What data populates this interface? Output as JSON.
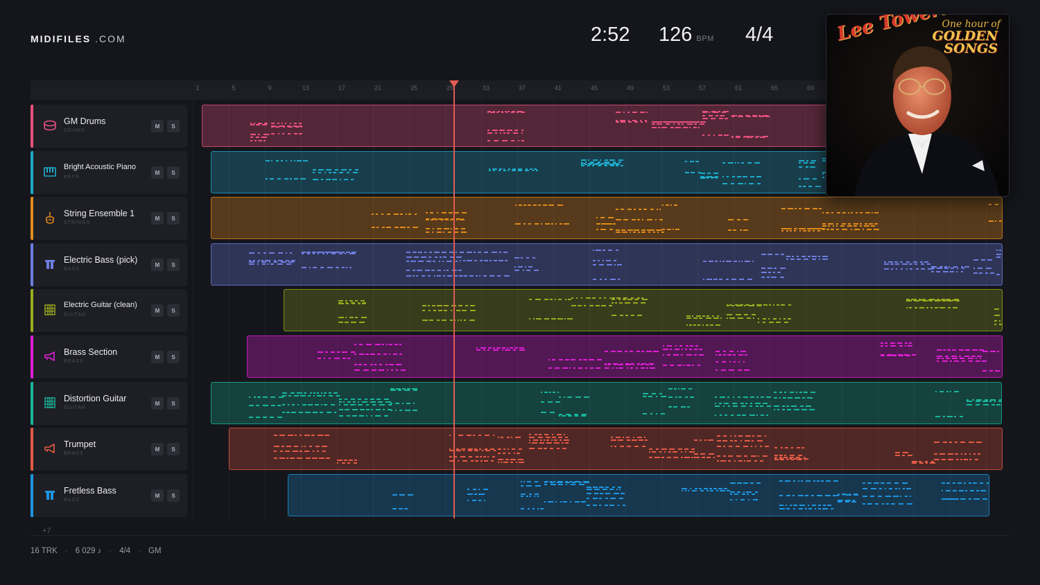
{
  "brand": {
    "name": "MIDIFILES",
    "tld": ".COM"
  },
  "transport": {
    "time": "2:52",
    "bpm": "126",
    "bpm_unit": "BPM",
    "signature": "4/4"
  },
  "ruler": {
    "ticks": [
      "1",
      "5",
      "9",
      "13",
      "17",
      "21",
      "25",
      "29",
      "33",
      "37",
      "41",
      "45",
      "49",
      "53",
      "57",
      "61",
      "65",
      "69"
    ]
  },
  "tracks": [
    {
      "name": "GM Drums",
      "category": "DRUMS",
      "color": "#e8507f",
      "icon": "drum-icon",
      "m": "M",
      "s": "S"
    },
    {
      "name": "Bright Acoustic Piano",
      "category": "KEYS",
      "color": "#1fa9c9",
      "icon": "piano-icon",
      "m": "M",
      "s": "S"
    },
    {
      "name": "String Ensemble 1",
      "category": "STRINGS",
      "color": "#e08a1c",
      "icon": "violin-icon",
      "m": "M",
      "s": "S"
    },
    {
      "name": "Electric Bass (pick)",
      "category": "BASS",
      "color": "#6d7de0",
      "icon": "bass-icon",
      "m": "M",
      "s": "S"
    },
    {
      "name": "Electric Guitar (clean)",
      "category": "GUITAR",
      "color": "#9aab1e",
      "icon": "guitar-icon",
      "m": "M",
      "s": "S"
    },
    {
      "name": "Brass Section",
      "category": "BRASS",
      "color": "#e01ed6",
      "icon": "horn-icon",
      "m": "M",
      "s": "S"
    },
    {
      "name": "Distortion Guitar",
      "category": "GUITAR",
      "color": "#19b69b",
      "icon": "guitar-icon",
      "m": "M",
      "s": "S"
    },
    {
      "name": "Trumpet",
      "category": "BRASS",
      "color": "#e55a45",
      "icon": "horn-icon",
      "m": "M",
      "s": "S"
    },
    {
      "name": "Fretless Bass",
      "category": "BASS",
      "color": "#1e95e0",
      "icon": "bass-icon",
      "m": "M",
      "s": "S"
    }
  ],
  "more_tracks": "+7",
  "footer": {
    "tracks": "16 TRK",
    "notes": "6 029 ♪",
    "signature": "4/4",
    "standard": "GM"
  },
  "album": {
    "artist": "Lee Towers",
    "title_line1": "One hour of",
    "title_line2": "GOLDEN",
    "title_line3": "SONGS"
  }
}
